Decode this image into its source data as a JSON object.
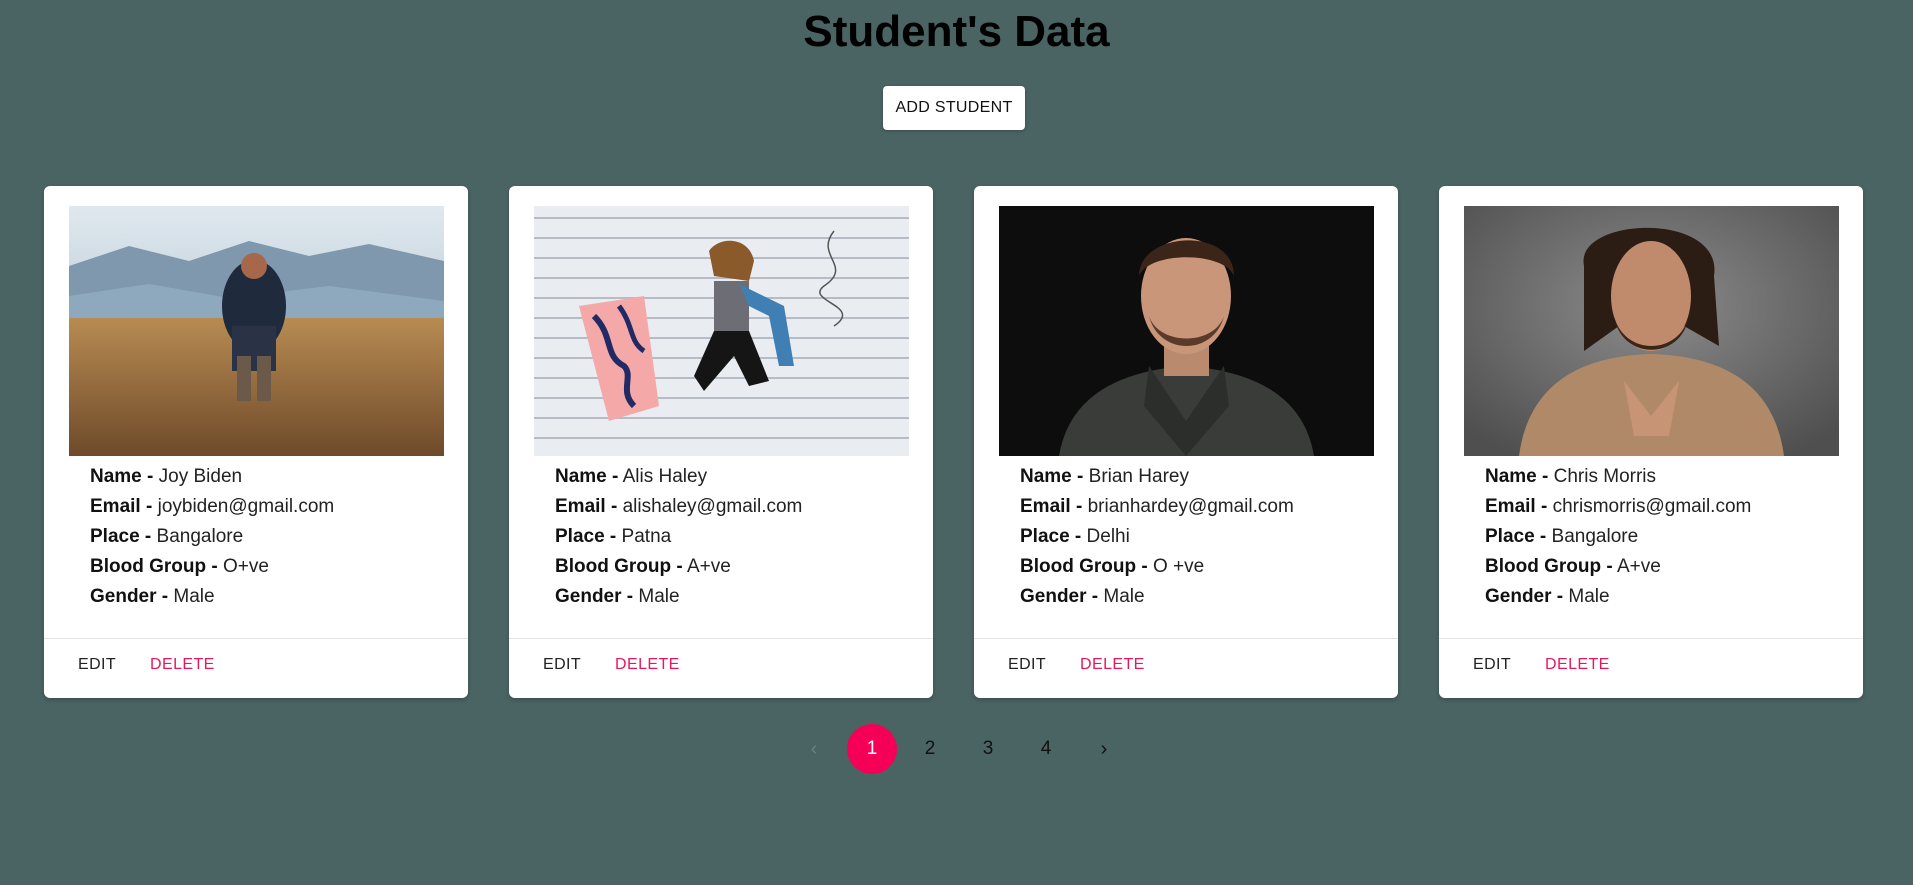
{
  "header": {
    "title": "Student's Data",
    "add_button": "ADD STUDENT"
  },
  "labels": {
    "name": "Name -",
    "email": "Email -",
    "place": "Place -",
    "blood_group": "Blood Group -",
    "gender": "Gender -"
  },
  "students": [
    {
      "name": "Joy Biden",
      "email": "joybiden@gmail.com",
      "place": "Bangalore",
      "blood_group": "O+ve",
      "gender": "Male",
      "edit": "EDIT",
      "delete": "DELETE"
    },
    {
      "name": "Alis Haley",
      "email": "alishaley@gmail.com",
      "place": "Patna",
      "blood_group": "A+ve",
      "gender": "Male",
      "edit": "EDIT",
      "delete": "DELETE"
    },
    {
      "name": "Brian Harey",
      "email": "brianhardey@gmail.com",
      "place": "Delhi",
      "blood_group": "O +ve",
      "gender": "Male",
      "edit": "EDIT",
      "delete": "DELETE"
    },
    {
      "name": "Chris Morris",
      "email": "chrismorris@gmail.com",
      "place": "Bangalore",
      "blood_group": "A+ve",
      "gender": "Male",
      "edit": "EDIT",
      "delete": "DELETE"
    }
  ],
  "pagination": {
    "prev_icon": "chevron-left-icon",
    "next_icon": "chevron-right-icon",
    "pages": [
      "1",
      "2",
      "3",
      "4"
    ],
    "current": "1"
  },
  "colors": {
    "background": "#4a6363",
    "accent": "#f50057",
    "delete": "#e8175d"
  }
}
